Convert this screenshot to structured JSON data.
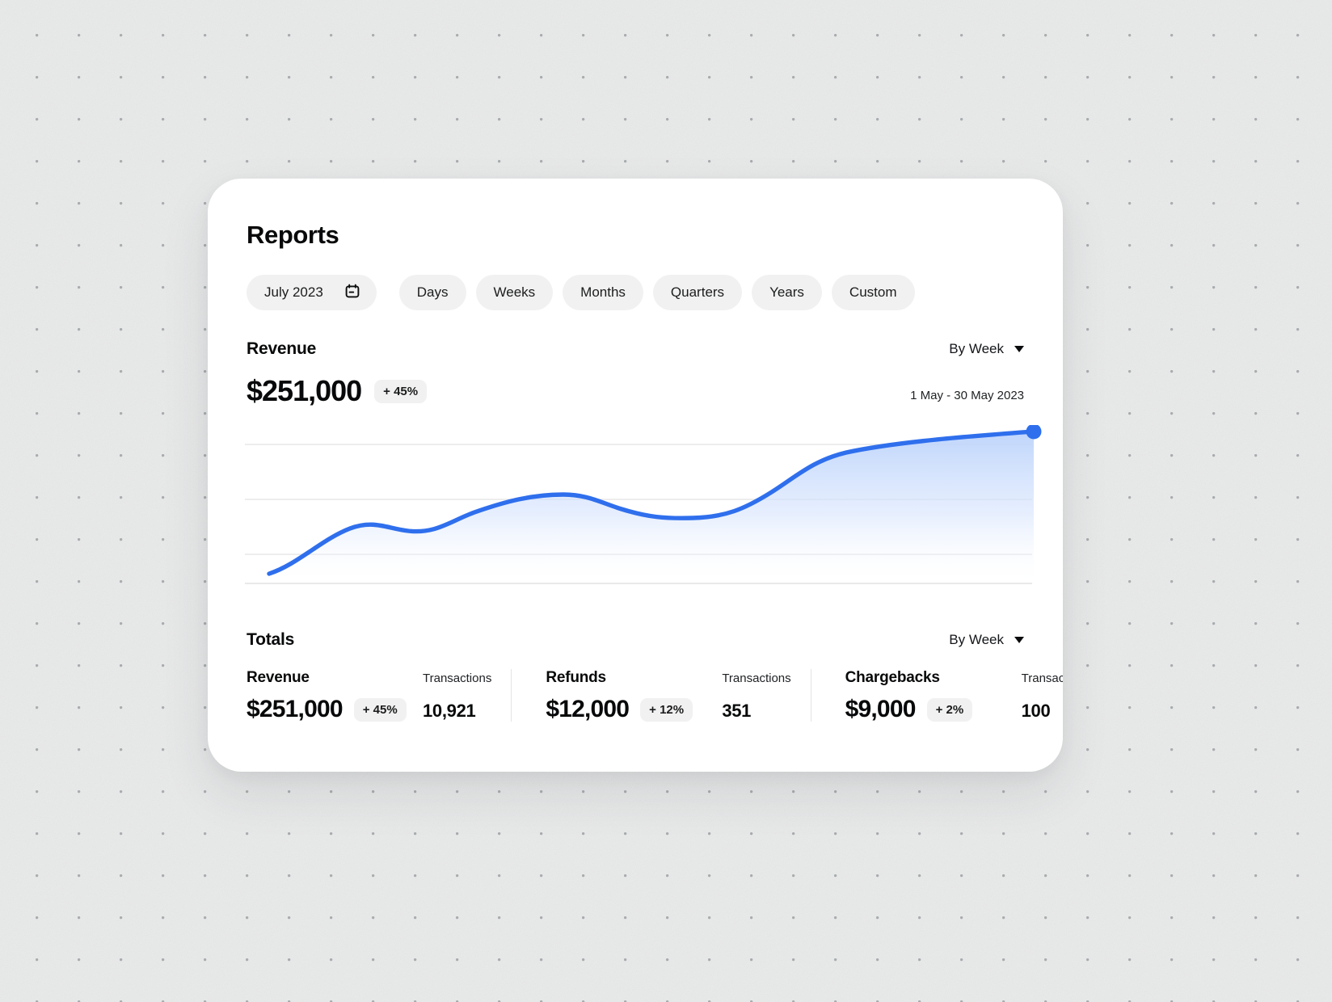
{
  "page": {
    "title": "Reports"
  },
  "filters": {
    "date_picker": {
      "value": "July 2023",
      "icon": "calendar-icon"
    },
    "ranges": [
      {
        "label": "Days"
      },
      {
        "label": "Weeks"
      },
      {
        "label": "Months"
      },
      {
        "label": "Quarters"
      },
      {
        "label": "Years"
      },
      {
        "label": "Custom"
      }
    ]
  },
  "revenue": {
    "title": "Revenue",
    "grouping": "By Week",
    "grouping_icon": "chevron-down-icon",
    "amount": "$251,000",
    "change": "+ 45%",
    "date_range": "1 May - 30 May 2023"
  },
  "totals": {
    "title": "Totals",
    "grouping": "By Week",
    "grouping_icon": "chevron-down-icon",
    "transactions_label": "Transactions",
    "columns": [
      {
        "name": "Revenue",
        "sub_label": "Transactions",
        "amount": "$251,000",
        "change": "+ 45%",
        "transactions": "10,921"
      },
      {
        "name": "Refunds",
        "sub_label": "Transactions",
        "amount": "$12,000",
        "change": "+ 12%",
        "transactions": "351"
      },
      {
        "name": "Chargebacks",
        "sub_label": "Transactions",
        "amount": "$9,000",
        "change": "+ 2%",
        "transactions": "100"
      }
    ]
  },
  "colors": {
    "accent": "#2f6fed",
    "area_top": "#bcd3fb",
    "card": "#ffffff",
    "pill": "#f1f1f1",
    "page_background": "#e9eaea",
    "gridline": "#e7e7e7"
  },
  "chart_data": {
    "type": "area",
    "title": "Revenue",
    "xlabel": "",
    "ylabel": "",
    "grid": true,
    "legend": false,
    "gridlines_y": [
      3,
      2,
      1
    ],
    "series": [
      {
        "name": "Revenue",
        "x": [
          0,
          1,
          2,
          3,
          4,
          5,
          6,
          7,
          8,
          9,
          10
        ],
        "values": [
          0.05,
          0.42,
          0.5,
          0.45,
          0.56,
          0.68,
          0.66,
          0.6,
          0.6,
          0.9,
          1.0
        ]
      }
    ],
    "endpoint_marker": true,
    "endpoint_value": 1.0,
    "ylim": [
      0,
      1.08
    ],
    "xlim": [
      0,
      10
    ]
  }
}
